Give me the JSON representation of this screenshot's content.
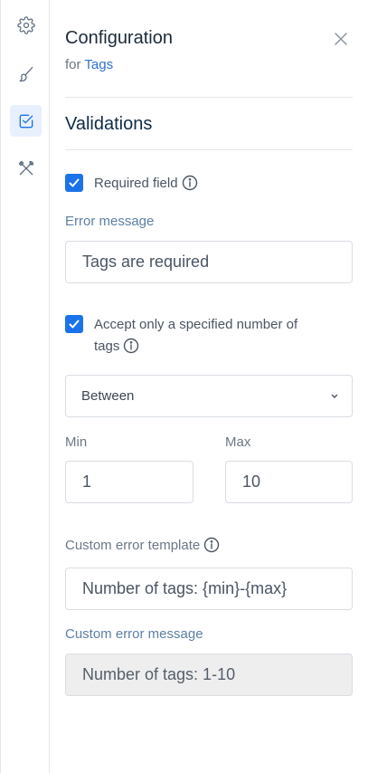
{
  "sidebar": {
    "items": [
      {
        "icon": "gear-icon",
        "active": false
      },
      {
        "icon": "brush-icon",
        "active": false
      },
      {
        "icon": "checkbox-icon",
        "active": true
      },
      {
        "icon": "tools-icon",
        "active": false
      }
    ]
  },
  "header": {
    "title": "Configuration",
    "subtitle_prefix": "for",
    "subtitle_link": "Tags"
  },
  "section": {
    "title": "Validations"
  },
  "required": {
    "checked": true,
    "label": "Required field",
    "error_label": "Error message",
    "error_value": "Tags are required"
  },
  "count": {
    "checked": true,
    "label_line1": "Accept only a specified number of",
    "label_line2": "tags",
    "mode": "Between",
    "min_label": "Min",
    "min_value": "1",
    "max_label": "Max",
    "max_value": "10"
  },
  "custom": {
    "template_label": "Custom error template",
    "template_value": "Number of tags: {min}-{max}",
    "message_label": "Custom error message",
    "message_value": "Number of tags: 1-10"
  },
  "colors": {
    "accent": "#1a73e8",
    "active_rail_bg": "#e8f0fd",
    "link": "#2f6fd6"
  }
}
